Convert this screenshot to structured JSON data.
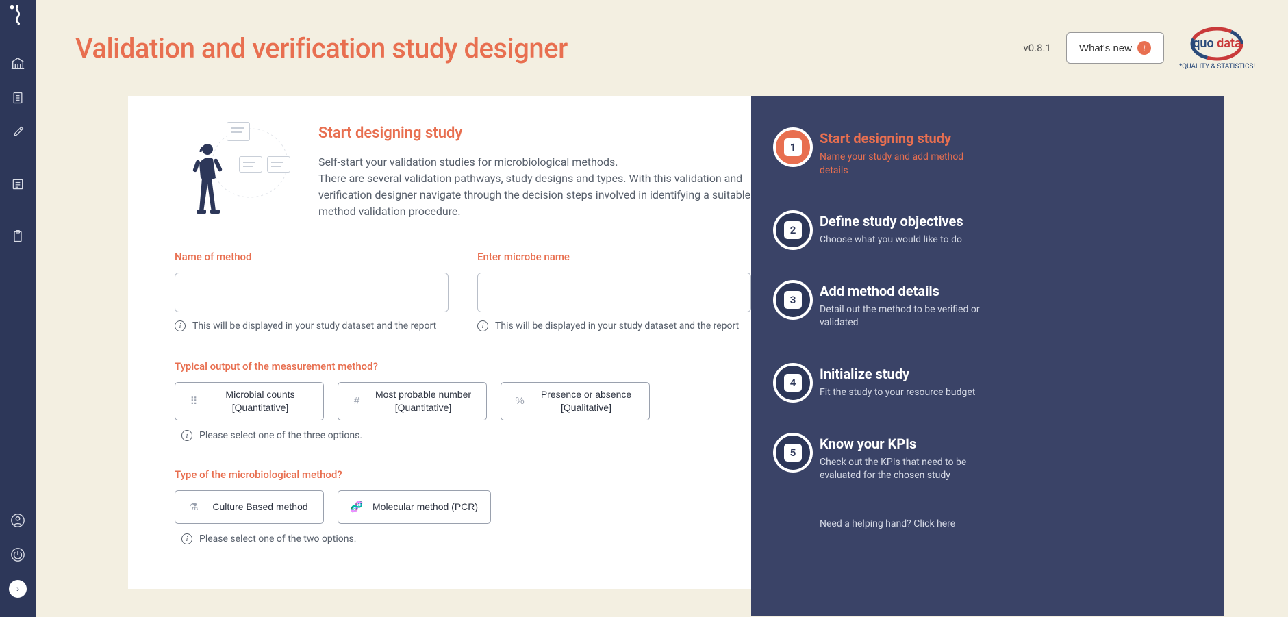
{
  "header": {
    "title": "Validation and verification study designer",
    "version": "v0.8.1",
    "whats_new": "What's new",
    "brand_name_quo": "quo",
    "brand_name_data": "data",
    "brand_tagline": "*QUALITY & STATISTICS!"
  },
  "card": {
    "heading": "Start designing study",
    "desc_line1": "Self-start your validation studies for microbiological methods.",
    "desc_line2": "There are several validation pathways, study designs and types. With this validation and verification designer navigate through the decision steps involved in identifying a suitable method validation procedure."
  },
  "form": {
    "name_label": "Name of method",
    "name_value": "",
    "name_helper": "This will be displayed in your study dataset and the report",
    "microbe_label": "Enter microbe name",
    "microbe_value": "",
    "microbe_helper": "This will be displayed in your study dataset and the report",
    "output_label": "Typical output of the measurement method?",
    "output_helper": "Please select one of the three options.",
    "output_options": [
      {
        "title": "Microbial counts",
        "sub": "[Quantitative]",
        "icon": "⠿"
      },
      {
        "title": "Most probable number",
        "sub": "[Quantitative]",
        "icon": "#"
      },
      {
        "title": "Presence or absence",
        "sub": "[Qualitative]",
        "icon": "%"
      }
    ],
    "type_label": "Type of the microbiological method?",
    "type_helper": "Please select one of the two options.",
    "type_options": [
      {
        "title": "Culture Based method",
        "icon": "⚗"
      },
      {
        "title": "Molecular method (PCR)",
        "icon": "🧬"
      }
    ]
  },
  "steps": [
    {
      "title": "Start designing study",
      "sub": "Name your study and add method details",
      "active": true
    },
    {
      "title": "Define study objectives",
      "sub": "Choose what you would like to do",
      "active": false
    },
    {
      "title": "Add method details",
      "sub": "Detail out the method to be verified or validated",
      "active": false
    },
    {
      "title": "Initialize study",
      "sub": "Fit the study to your resource budget",
      "active": false
    },
    {
      "title": "Know your KPIs",
      "sub": "Check out the KPIs that need to be evaluated for the chosen study",
      "active": false
    }
  ],
  "help_text": "Need a helping hand? Click here"
}
